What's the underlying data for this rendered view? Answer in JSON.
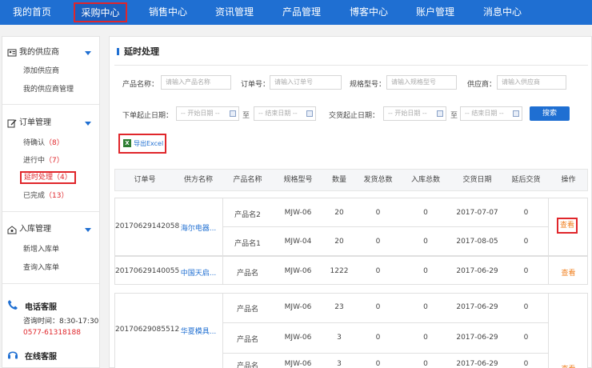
{
  "nav": [
    "我的首页",
    "采购中心",
    "销售中心",
    "资讯管理",
    "产品管理",
    "博客中心",
    "账户管理",
    "消息中心"
  ],
  "sidebar": {
    "supplier": {
      "title": "我的供应商",
      "items": [
        "添加供应商",
        "我的供应商管理"
      ]
    },
    "orders": {
      "title": "订单管理",
      "items": [
        {
          "label": "待确认",
          "count": "（8）"
        },
        {
          "label": "进行中",
          "count": "（7）"
        },
        {
          "label": "延时处理",
          "count": "（4）"
        },
        {
          "label": "已完成",
          "count": "（13）"
        }
      ]
    },
    "inbound": {
      "title": "入库管理",
      "items": [
        "新增入库单",
        "查询入库单"
      ]
    },
    "phone_service": {
      "title": "电话客服",
      "hours": "咨询时间：8:30-17:30",
      "phone": "0577-61318188"
    },
    "online_service": {
      "title": "在线客服"
    }
  },
  "main": {
    "title": "延时处理",
    "filters": {
      "product_label": "产品名称：",
      "product_placeholder": "请输入产品名称",
      "order_label": "订单号：",
      "order_placeholder": "请输入订单号",
      "spec_label": "规格型号：",
      "spec_placeholder": "请输入规格型号",
      "supplier_label": "供应商：",
      "supplier_placeholder": "请输入供应商",
      "order_date_label": "下单起止日期：",
      "start_placeholder": "-- 开始日期 --",
      "end_placeholder": "-- 结束日期 --",
      "delivery_date_label": "交货起止日期：",
      "range_sep": "至",
      "search_label": "搜索"
    },
    "export_label": "导出Excel",
    "columns": [
      "订单号",
      "供方名称",
      "产品名称",
      "规格型号",
      "数量",
      "发货总数",
      "入库总数",
      "交货日期",
      "延后交货",
      "操作"
    ],
    "orders": [
      {
        "order_no": "20170629142058",
        "supplier": "海尔电器...",
        "action": "查看",
        "items": [
          {
            "product": "产品名2",
            "spec": "MJW-06",
            "qty": "20",
            "shipped": "0",
            "stocked": "0",
            "date": "2017-07-07",
            "delay": "0"
          },
          {
            "product": "产品名1",
            "spec": "MJW-04",
            "qty": "20",
            "shipped": "0",
            "stocked": "0",
            "date": "2017-08-05",
            "delay": "0"
          }
        ]
      },
      {
        "order_no": "20170629140055",
        "supplier": "中国天启...",
        "action": "查看",
        "items": [
          {
            "product": "产品名",
            "spec": "MJW-06",
            "qty": "1222",
            "shipped": "0",
            "stocked": "0",
            "date": "2017-06-29",
            "delay": "0"
          }
        ]
      },
      {
        "order_no": "20170629085512",
        "supplier": "华夏模具...",
        "action": "查看",
        "items": [
          {
            "product": "产品名",
            "spec": "MJW-06",
            "qty": "23",
            "shipped": "0",
            "stocked": "0",
            "date": "2017-06-29",
            "delay": "0"
          },
          {
            "product": "产品名",
            "spec": "MJW-06",
            "qty": "3",
            "shipped": "0",
            "stocked": "0",
            "date": "2017-06-29",
            "delay": "0"
          },
          {
            "product": "产品名",
            "spec": "MJW-06",
            "qty": "3",
            "shipped": "0",
            "stocked": "0",
            "date": "2017-06-29",
            "delay": "0"
          }
        ]
      }
    ]
  },
  "colors": {
    "nav_bg": "#1f6fd2",
    "highlight": "#e0262b",
    "action": "#f07f1e"
  }
}
